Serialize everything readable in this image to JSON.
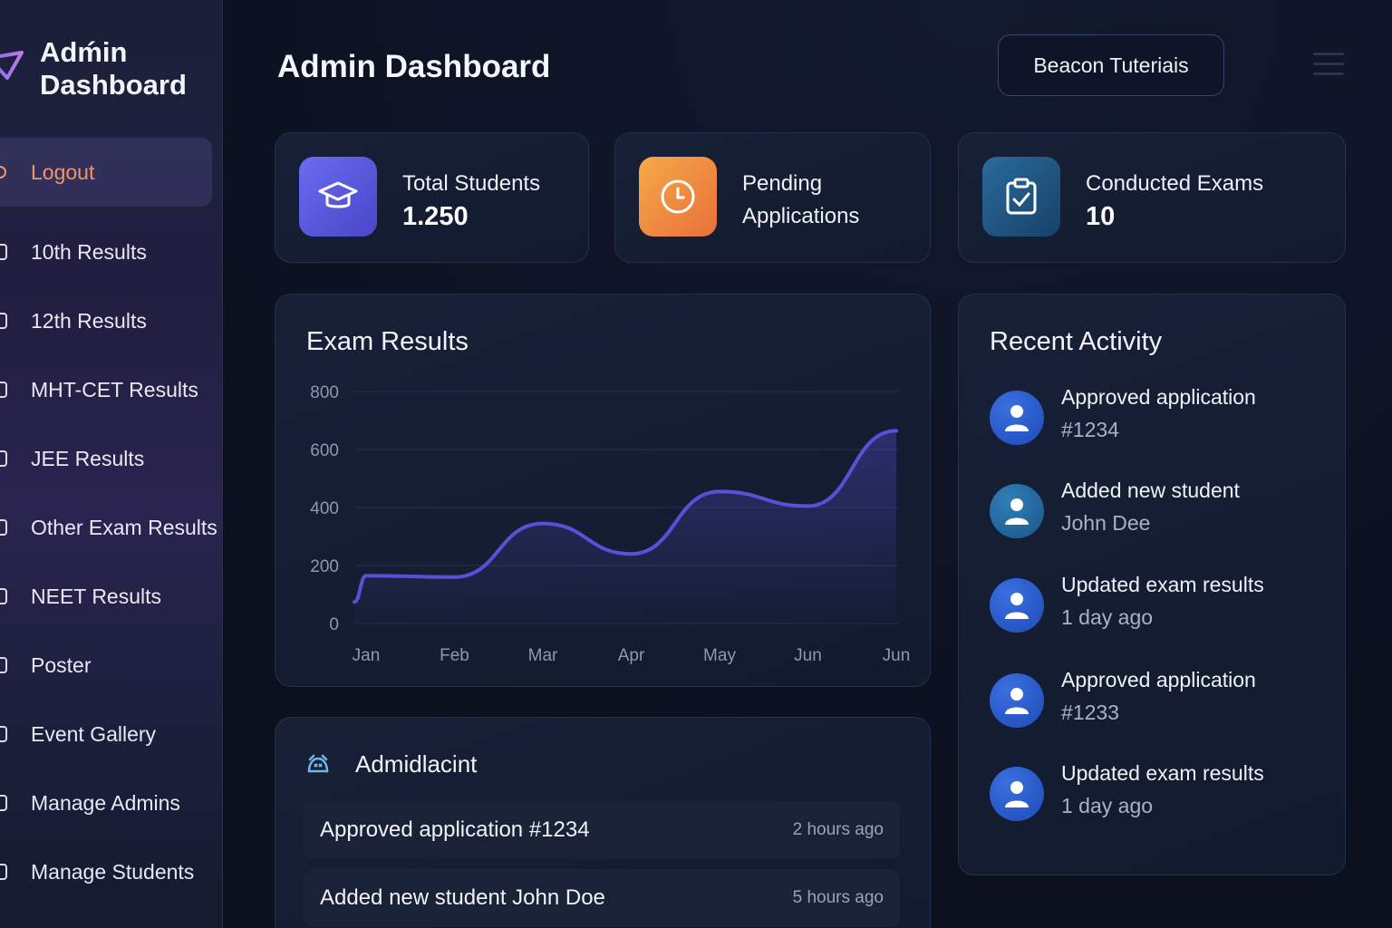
{
  "sidebar": {
    "brand_line1": "Adḿin",
    "brand_line2": "Dashboard",
    "items": [
      {
        "label": "Logout"
      },
      {
        "label": "10th Results"
      },
      {
        "label": "12th Results"
      },
      {
        "label": "MHT-CET Results"
      },
      {
        "label": "JEE Results"
      },
      {
        "label": "Other Exam Results"
      },
      {
        "label": "NEET Results"
      },
      {
        "label": "Poster"
      },
      {
        "label": "Event Gallery"
      },
      {
        "label": "Manage Admins"
      },
      {
        "label": "Manage Students"
      }
    ]
  },
  "header": {
    "title": "Admin Dashboard",
    "org_button": "Beacon Tuteriais"
  },
  "stats": {
    "students": {
      "label": "Total Students",
      "value": "1.250",
      "icon": "graduation-cap-icon",
      "color": "#5b5bd6"
    },
    "pending": {
      "label_line1": "Pending",
      "label_line2": "Applications",
      "icon": "clock-icon",
      "color": "#f0883e"
    },
    "exams": {
      "label": "Conducted Exams",
      "value": "10",
      "icon": "clipboard-check-icon",
      "color": "#1f5a88"
    }
  },
  "chart_data": {
    "type": "area",
    "title": "Exam Results",
    "categories": [
      "Jan",
      "Feb",
      "Mar",
      "Apr",
      "May",
      "Jun",
      "Jun"
    ],
    "values": [
      165,
      160,
      345,
      240,
      455,
      405,
      665
    ],
    "yticks": [
      0,
      200,
      400,
      600,
      800
    ],
    "ylim": [
      0,
      800
    ],
    "line_color": "#5b4fd8"
  },
  "recent_activity": {
    "title": "Recent Activity",
    "items": [
      {
        "line1": "Approved application",
        "line2": "#1234"
      },
      {
        "line1": "Added new student",
        "line2": "John Dee"
      },
      {
        "line1": "Updated exam results",
        "line2": "1 day ago"
      },
      {
        "line1": "Approved application",
        "line2": "#1233"
      },
      {
        "line1": "Updated exam results",
        "line2": "1 day ago"
      }
    ]
  },
  "admin_activity": {
    "title": "Admidlacint",
    "rows": [
      {
        "text": "Approved application #1234",
        "time": "2 hours ago"
      },
      {
        "text": "Added new student  John Doe",
        "time": "5 hours ago"
      }
    ]
  }
}
